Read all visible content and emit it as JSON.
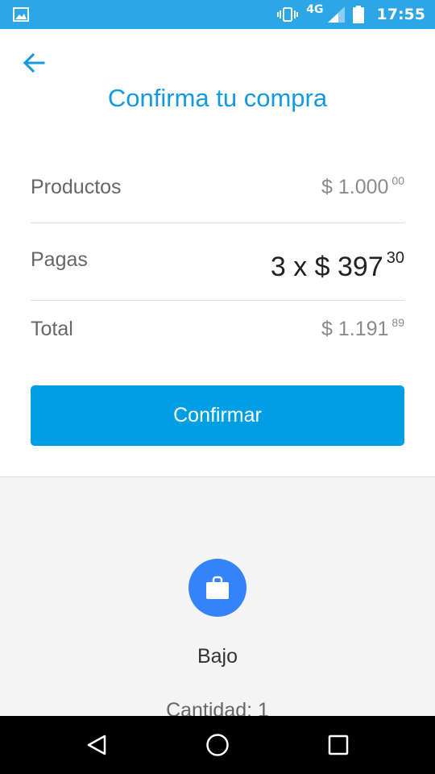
{
  "status_bar": {
    "network": "4G",
    "time": "17:55",
    "color": "#2da6e6",
    "icons": [
      "gallery-icon",
      "vibrate-icon",
      "signal-icon",
      "battery-icon"
    ]
  },
  "header": {
    "back_icon": "arrow-left-icon",
    "title": "Confirma tu compra",
    "title_color": "#1499df"
  },
  "summary": {
    "products": {
      "label": "Productos",
      "amount": "$ 1.000",
      "cents": "00"
    },
    "payments": {
      "label": "Pagas",
      "amount": "3 x $ 397",
      "cents": "30"
    },
    "total": {
      "label": "Total",
      "amount": "$ 1.191",
      "cents": "89"
    }
  },
  "confirm_button": {
    "label": "Confirmar",
    "color": "#009ee3"
  },
  "product": {
    "icon": "shopping-bag-icon",
    "icon_color": "#3483fa",
    "name": "Bajo",
    "quantity": "Cantidad: 1"
  },
  "nav_bar": {
    "icons": [
      "nav-back-icon",
      "nav-home-icon",
      "nav-recents-icon"
    ]
  }
}
